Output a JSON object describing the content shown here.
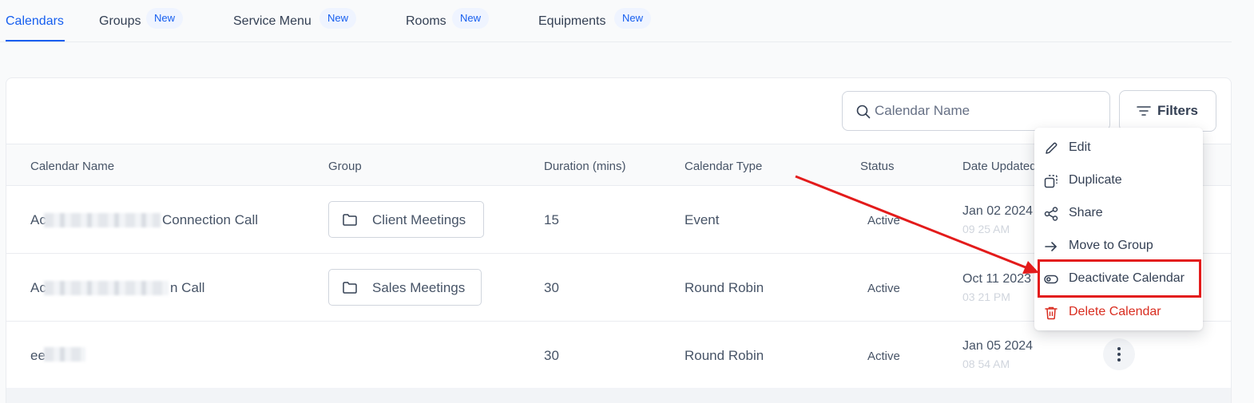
{
  "tabs": [
    {
      "label": "Calendars",
      "badge": ""
    },
    {
      "label": "Groups",
      "badge": "New"
    },
    {
      "label": "Service Menu",
      "badge": "New"
    },
    {
      "label": "Rooms",
      "badge": "New"
    },
    {
      "label": "Equipments",
      "badge": "New"
    }
  ],
  "toolbar": {
    "search_placeholder": "Calendar Name",
    "filters_label": "Filters"
  },
  "table": {
    "columns": [
      "Calendar Name",
      "Group",
      "Duration (mins)",
      "Calendar Type",
      "Status",
      "Date Updated"
    ],
    "rows": [
      {
        "name_prefix": "Ac",
        "name_suffix": "Connection Call",
        "group": "Client Meetings",
        "duration": "15",
        "type": "Event",
        "status": "Active",
        "date": "Jan 02 2024",
        "time": "09 25 AM"
      },
      {
        "name_prefix": "Ac",
        "name_suffix": "n Call",
        "group": "Sales Meetings",
        "duration": "30",
        "type": "Round Robin",
        "status": "Active",
        "date": "Oct 11 2023",
        "time": "03 21 PM"
      },
      {
        "name_prefix": "ee",
        "name_suffix": "",
        "group": "",
        "duration": "30",
        "type": "Round Robin",
        "status": "Active",
        "date": "Jan 05 2024",
        "time": "08 54 AM"
      }
    ]
  },
  "menu": {
    "items": [
      {
        "label": "Edit",
        "icon": "pencil-icon"
      },
      {
        "label": "Duplicate",
        "icon": "duplicate-icon"
      },
      {
        "label": "Share",
        "icon": "share-icon"
      },
      {
        "label": "Move to Group",
        "icon": "arrow-right-icon"
      },
      {
        "label": "Deactivate Calendar",
        "icon": "toggle-icon"
      },
      {
        "label": "Delete Calendar",
        "icon": "trash-icon"
      }
    ]
  },
  "colors": {
    "accent": "#155eef",
    "danger": "#d92d20",
    "annotation": "#e31b1b"
  }
}
